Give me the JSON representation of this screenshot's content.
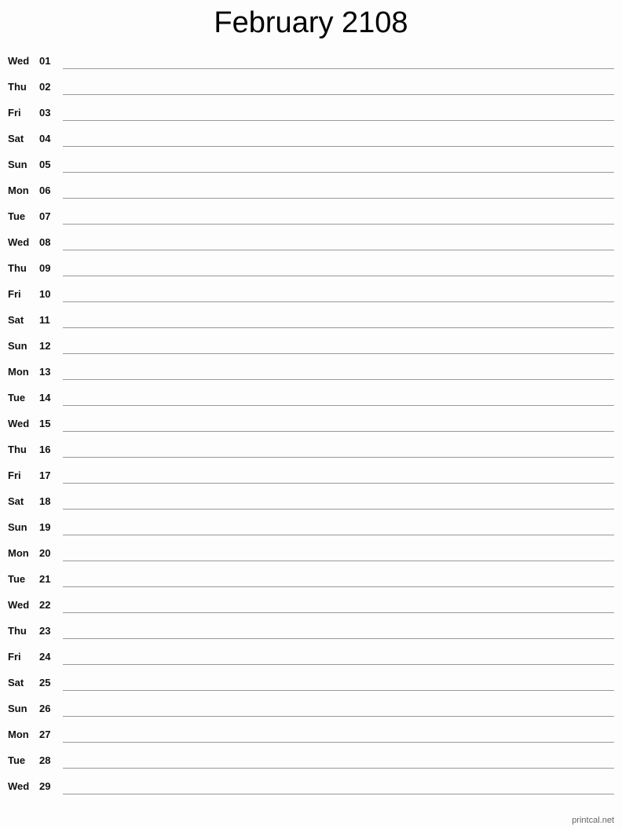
{
  "title": "February 2108",
  "days": [
    {
      "dow": "Wed",
      "day": "01"
    },
    {
      "dow": "Thu",
      "day": "02"
    },
    {
      "dow": "Fri",
      "day": "03"
    },
    {
      "dow": "Sat",
      "day": "04"
    },
    {
      "dow": "Sun",
      "day": "05"
    },
    {
      "dow": "Mon",
      "day": "06"
    },
    {
      "dow": "Tue",
      "day": "07"
    },
    {
      "dow": "Wed",
      "day": "08"
    },
    {
      "dow": "Thu",
      "day": "09"
    },
    {
      "dow": "Fri",
      "day": "10"
    },
    {
      "dow": "Sat",
      "day": "11"
    },
    {
      "dow": "Sun",
      "day": "12"
    },
    {
      "dow": "Mon",
      "day": "13"
    },
    {
      "dow": "Tue",
      "day": "14"
    },
    {
      "dow": "Wed",
      "day": "15"
    },
    {
      "dow": "Thu",
      "day": "16"
    },
    {
      "dow": "Fri",
      "day": "17"
    },
    {
      "dow": "Sat",
      "day": "18"
    },
    {
      "dow": "Sun",
      "day": "19"
    },
    {
      "dow": "Mon",
      "day": "20"
    },
    {
      "dow": "Tue",
      "day": "21"
    },
    {
      "dow": "Wed",
      "day": "22"
    },
    {
      "dow": "Thu",
      "day": "23"
    },
    {
      "dow": "Fri",
      "day": "24"
    },
    {
      "dow": "Sat",
      "day": "25"
    },
    {
      "dow": "Sun",
      "day": "26"
    },
    {
      "dow": "Mon",
      "day": "27"
    },
    {
      "dow": "Tue",
      "day": "28"
    },
    {
      "dow": "Wed",
      "day": "29"
    }
  ],
  "footer": "printcal.net"
}
